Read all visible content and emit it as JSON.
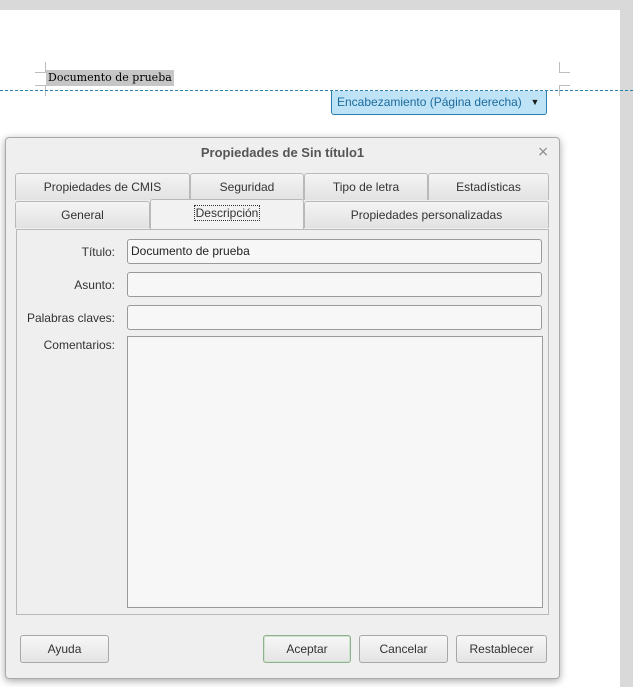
{
  "document": {
    "body_text": "Documento de prueba",
    "header_tag": "Encabezamiento (Página derecha)",
    "header_arrow": "▼"
  },
  "dialog": {
    "title": "Propiedades de Sin título1",
    "close_glyph": "×",
    "tabs_row1": [
      "Propiedades de CMIS",
      "Seguridad",
      "Tipo de letra",
      "Estadísticas"
    ],
    "tabs_row2": [
      "General",
      "Descripción",
      "Propiedades personalizadas"
    ],
    "active_tab": "Descripción",
    "fields": {
      "title_label": "Título:",
      "title_value": "Documento de prueba",
      "subject_label": "Asunto:",
      "subject_value": "",
      "keywords_label": "Palabras claves:",
      "keywords_value": "",
      "comments_label": "Comentarios:",
      "comments_value": ""
    },
    "buttons": {
      "help": "Ayuda",
      "ok": "Aceptar",
      "cancel": "Cancelar",
      "reset": "Restablecer"
    }
  }
}
